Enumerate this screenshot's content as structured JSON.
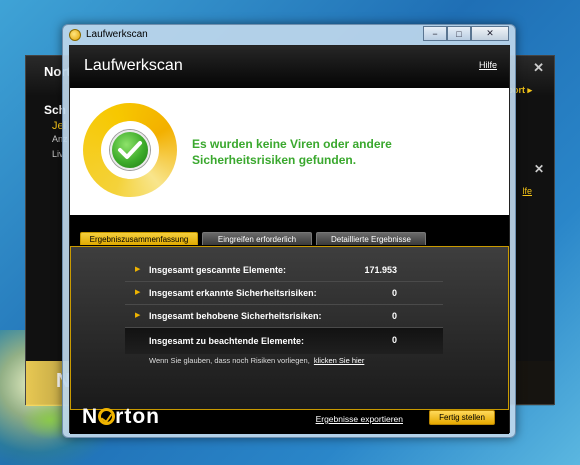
{
  "background_window": {
    "title": "Norton",
    "subtitle": "Sch",
    "line1": "Jel",
    "line2": "Anz",
    "line3": "Liv",
    "report_link": "eport ▸",
    "help_link": "lfe",
    "close": "✕",
    "brand": "N"
  },
  "window": {
    "title": "Laufwerkscan",
    "minimize": "−",
    "maximize": "□",
    "close": "✕"
  },
  "header": {
    "title": "Laufwerkscan",
    "help": "Hilfe"
  },
  "result": {
    "message": "Es wurden keine Viren oder andere Sicherheitsrisiken gefunden."
  },
  "tabs": [
    {
      "label": "Ergebniszusammenfassung",
      "active": true
    },
    {
      "label": "Eingreifen erforderlich",
      "active": false
    },
    {
      "label": "Detaillierte Ergebnisse",
      "active": false
    }
  ],
  "summary": {
    "rows": [
      {
        "label": "Insgesamt gescannte Elemente:",
        "value": "171.953"
      },
      {
        "label": "Insgesamt erkannte Sicherheitsrisiken:",
        "value": "0"
      },
      {
        "label": "Insgesamt behobene Sicherheitsrisiken:",
        "value": "0"
      },
      {
        "label": "Insgesamt zu beachtende Elemente:",
        "value": "0"
      }
    ],
    "note_text": "Wenn Sie glauben, dass noch Risiken vorliegen,",
    "note_link": "klicken Sie hier",
    "arrow": "▶"
  },
  "footer": {
    "logo_text_pre": "N",
    "logo_text_post": "rton",
    "export_link": "Ergebnisse exportieren",
    "done_button": "Fertig stellen"
  },
  "colors": {
    "accent_yellow": "#f0b400",
    "success_green": "#3aa82e"
  }
}
